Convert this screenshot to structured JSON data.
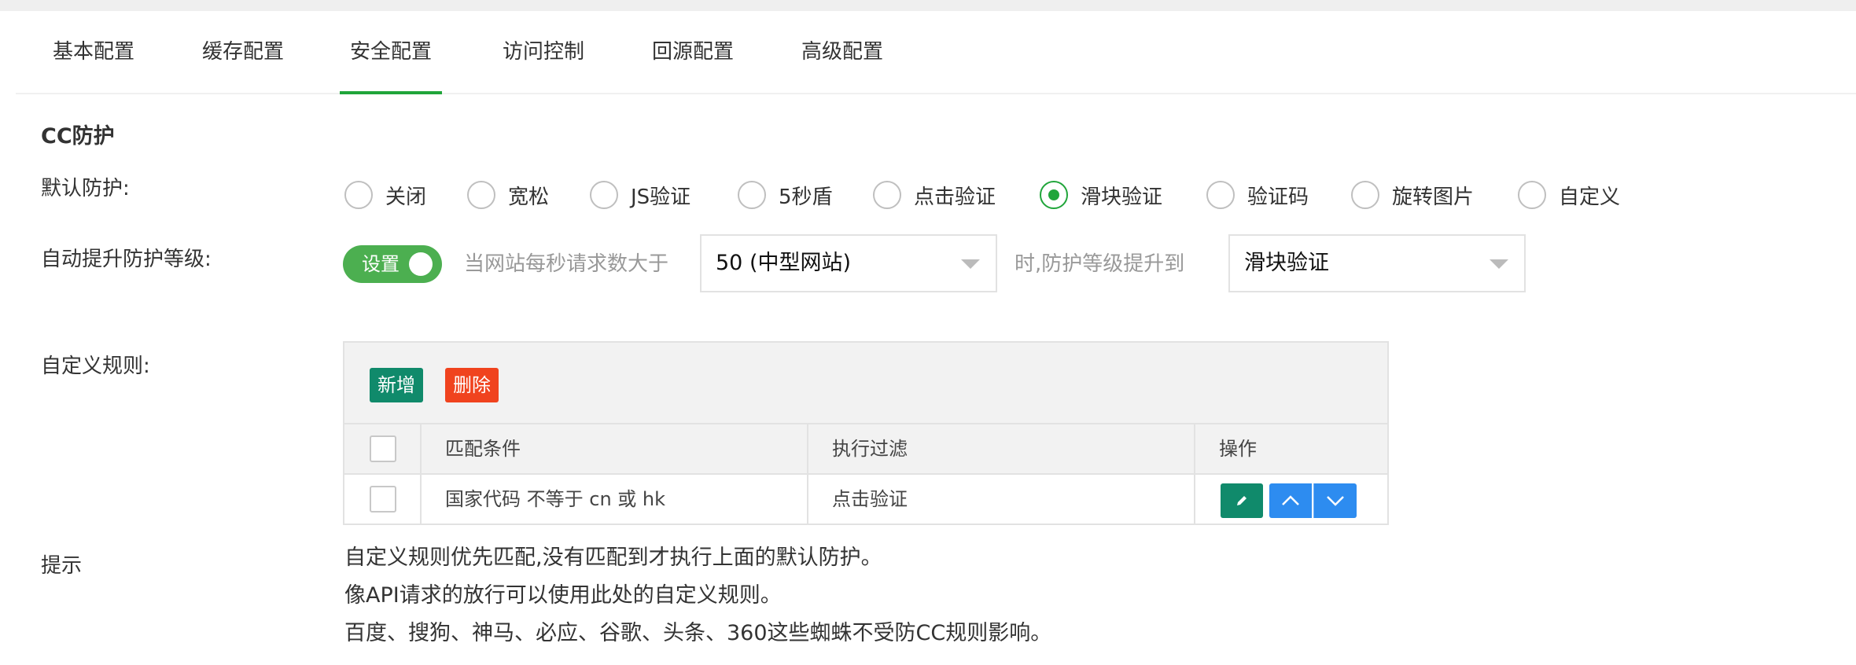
{
  "tabs": [
    {
      "label": "基本配置"
    },
    {
      "label": "缓存配置"
    },
    {
      "label": "安全配置",
      "active": true
    },
    {
      "label": "访问控制"
    },
    {
      "label": "回源配置"
    },
    {
      "label": "高级配置"
    }
  ],
  "cc": {
    "section_title": "CC防护",
    "default_label": "默认防护:",
    "options": [
      "关闭",
      "宽松",
      "JS验证",
      "5秒盾",
      "点击验证",
      "滑块验证",
      "验证码",
      "旋转图片",
      "自定义"
    ],
    "selected_option": "滑块验证",
    "auto_label": "自动提升防护等级:",
    "toggle_label": "设置",
    "toggle_on": true,
    "when_text": "当网站每秒请求数大于",
    "threshold_value": "50 (中型网站)",
    "then_text": "时,防护等级提升到",
    "level_value": "滑块验证"
  },
  "rules": {
    "label": "自定义规则:",
    "add_label": "新增",
    "delete_label": "删除",
    "columns": [
      "匹配条件",
      "执行过滤",
      "操作"
    ],
    "rows": [
      {
        "condition": "国家代码 不等于 cn 或 hk",
        "action": "点击验证"
      }
    ]
  },
  "tips": {
    "label": "提示",
    "lines": [
      "自定义规则优先匹配,没有匹配到才执行上面的默认防护。",
      "像API请求的放行可以使用此处的自定义规则。",
      "百度、搜狗、神马、必应、谷歌、头条、360这些蜘蛛不受防CC规则影响。"
    ]
  },
  "colors": {
    "accent_green": "#20a53a",
    "toggle_green": "#4caf50",
    "teal": "#108a6b",
    "red": "#f0431e",
    "blue": "#2d8cf0"
  }
}
